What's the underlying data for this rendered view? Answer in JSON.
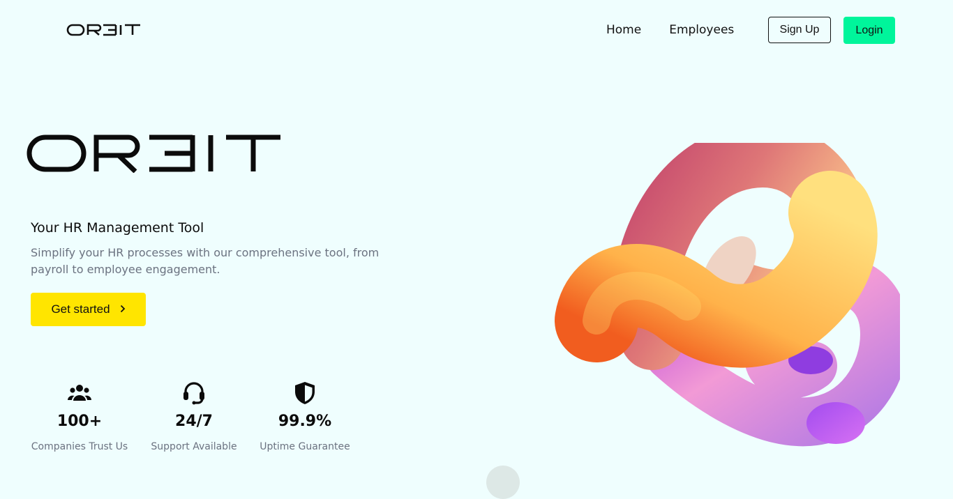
{
  "navbar": {
    "brand": "ORBIT",
    "links": [
      {
        "label": "Home"
      },
      {
        "label": "Employees"
      }
    ],
    "signup_label": "Sign Up",
    "login_label": "Login"
  },
  "hero": {
    "brand": "ORBIT",
    "tagline": "Your HR Management Tool",
    "description": "Simplify your HR processes with our comprehensive tool, from payroll to employee engagement.",
    "cta_label": "Get started",
    "cta_icon": "chevron-right-icon"
  },
  "stats": [
    {
      "icon": "users-icon",
      "value": "100+",
      "label": "Companies Trust Us"
    },
    {
      "icon": "headset-icon",
      "value": "24/7",
      "label": "Support Available"
    },
    {
      "icon": "shield-icon",
      "value": "99.9%",
      "label": "Uptime Guarantee"
    }
  ],
  "colors": {
    "background": "#effefe",
    "login_button": "#00f59b",
    "cta_button": "#ffe500",
    "muted_text": "#6b7280"
  }
}
